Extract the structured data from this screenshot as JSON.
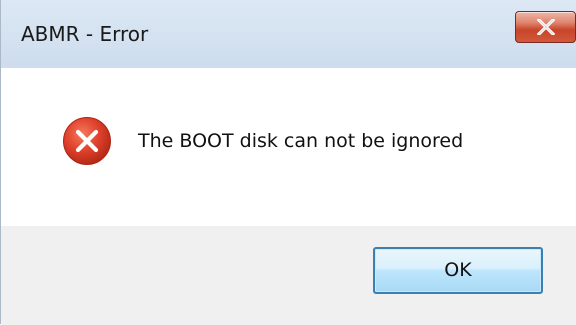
{
  "window": {
    "title": "ABMR - Error",
    "close_icon": "close-x-icon"
  },
  "message": {
    "icon": "error-icon",
    "text": "The BOOT disk can not be ignored"
  },
  "buttons": {
    "ok_label": "OK"
  },
  "colors": {
    "titlebar": "#d4e2f1",
    "close_button": "#c8452a",
    "error_icon": "#e0412c",
    "button_area": "#f0f0f0",
    "ok_border": "#3c7fb1"
  }
}
